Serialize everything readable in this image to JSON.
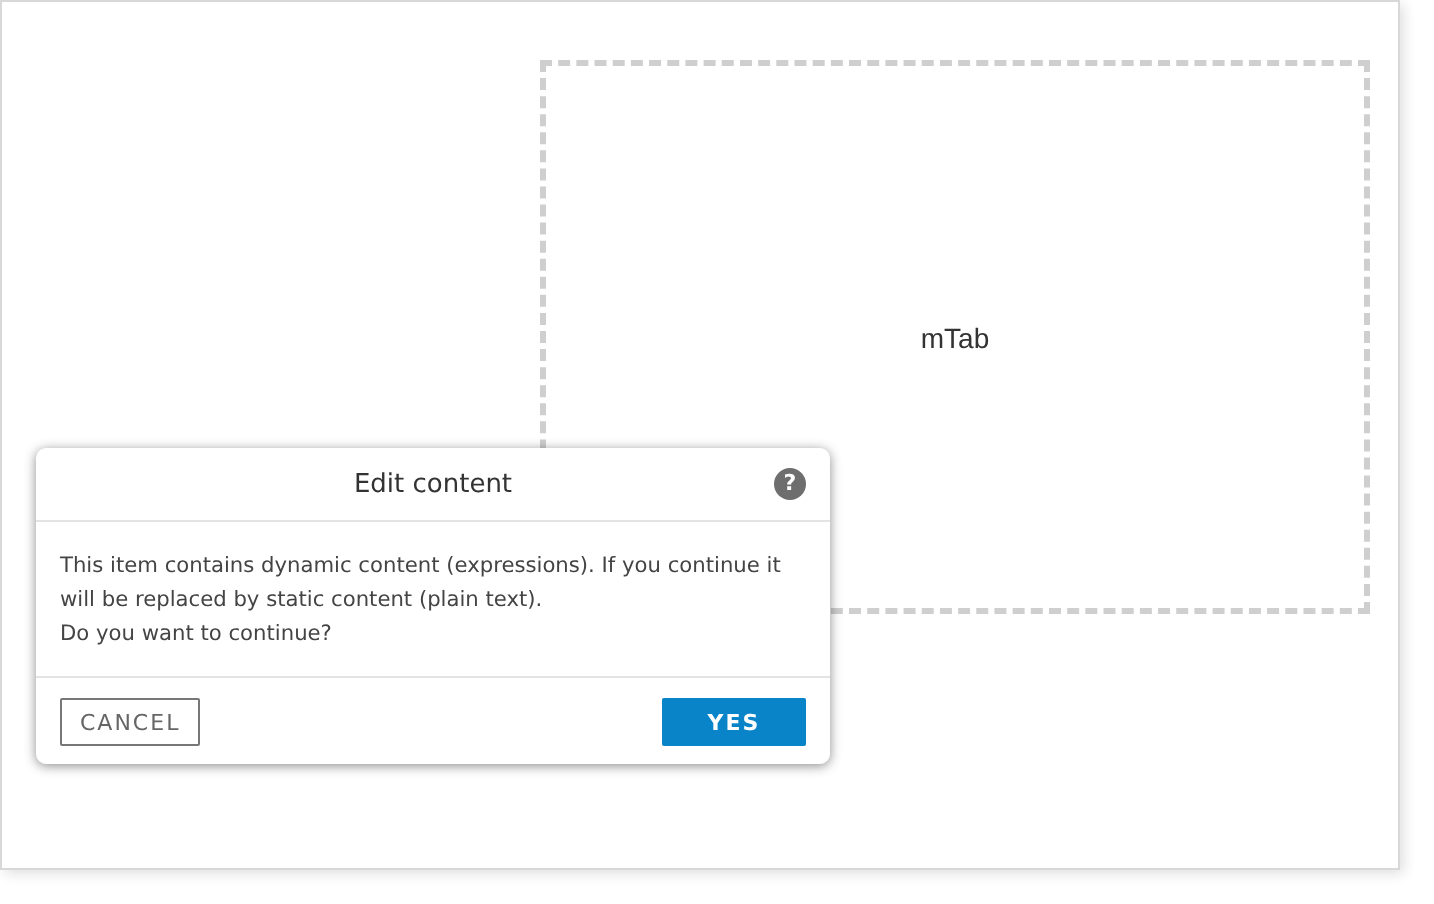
{
  "canvas": {
    "placeholder_label": "mTab"
  },
  "dialog": {
    "title": "Edit content",
    "help": "?",
    "message": [
      "This item contains dynamic content (expressions). If you continue it will be replaced by static content (plain text).",
      "Do you want to continue?"
    ],
    "buttons": [
      {
        "label": "CANCEL",
        "kind": "secondary"
      },
      {
        "label": "YES",
        "kind": "primary"
      }
    ]
  }
}
